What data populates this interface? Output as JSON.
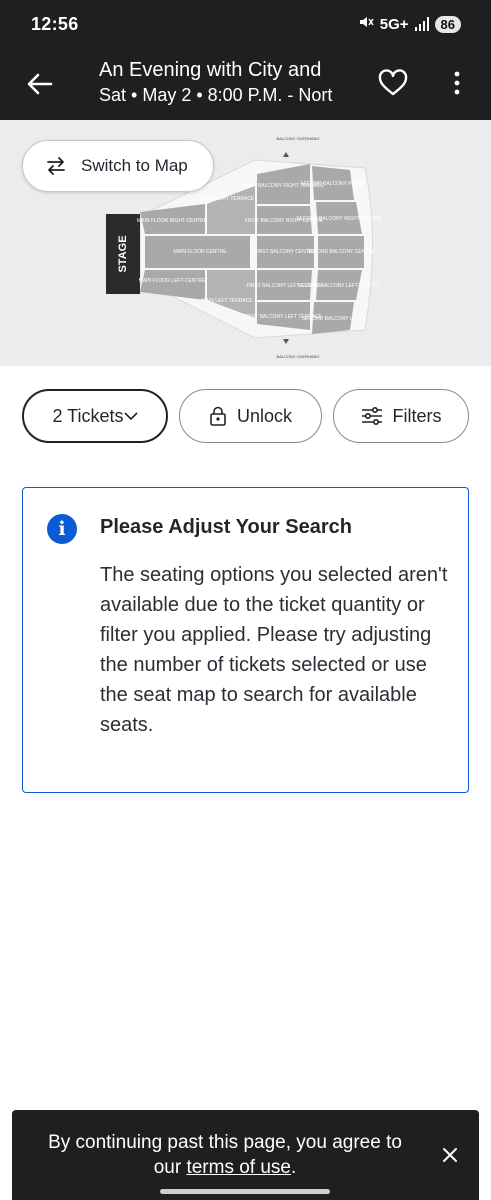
{
  "status_bar": {
    "time": "12:56",
    "network": "5G+",
    "battery": "86"
  },
  "header": {
    "title": "An Evening with City and",
    "subtitle": "Sat • May 2 • 8:00 P.M. - Nort"
  },
  "map": {
    "switch_label": "Switch to Map",
    "stage_label": "STAGE",
    "sections": {
      "balcony_overhang_top": "BALCONY OVERHANG",
      "balcony_overhang_bottom": "BALCONY OVERHANG",
      "main_right_terrace": "MAIN RIGHT TERRACE",
      "first_balcony_right_terrace": "FIRST BALCONY RIGHT TERRACE",
      "second_balcony_right": "SECOND BALCONY RIGHT",
      "main_floor_right_centre": "MAIN FLOOR RIGHT-CENTRE",
      "first_balcony_right_centre": "FIRST BALCONY RIGHT-CENTRE",
      "second_balcony_right_centre": "SECOND BALCONY RIGHT-CENTRE",
      "main_floor_centre": "MAIN FLOOR CENTRE",
      "first_balcony_centre": "FIRST BALCONY CENTRE",
      "second_balcony_centre": "SECOND BALCONY CENTRE",
      "main_floor_left_centre": "MAIN FLOOR LEFT-CENTRE",
      "first_balcony_left_centre": "FIRST BALCONY LEFT-CENTRE",
      "second_balcony_left_centre": "SECOND BALCONY LEFT-CENTRE",
      "main_left_terrace": "MAIN LEFT TERRACE",
      "first_balcony_left_terrace": "FIRST BALCONY LEFT TERRACE",
      "second_balcony_left": "SECOND BALCONY LEFT"
    }
  },
  "filters": {
    "tickets_label": "2 Tickets",
    "unlock_label": "Unlock",
    "filters_label": "Filters"
  },
  "notice": {
    "heading": "Please Adjust Your Search",
    "body": "The seating options you selected aren't available due to the ticket quantity or filter you applied. Please try adjusting the number of tickets selected or use the seat map to search for available seats."
  },
  "banner": {
    "text_before": "By continuing past this page, you agree to our ",
    "link": "terms of use",
    "text_after": "."
  },
  "colors": {
    "accent_blue": "#0b5bd4",
    "dark_bar": "#1f1f1f",
    "section_gray": "#a9a9a9"
  }
}
